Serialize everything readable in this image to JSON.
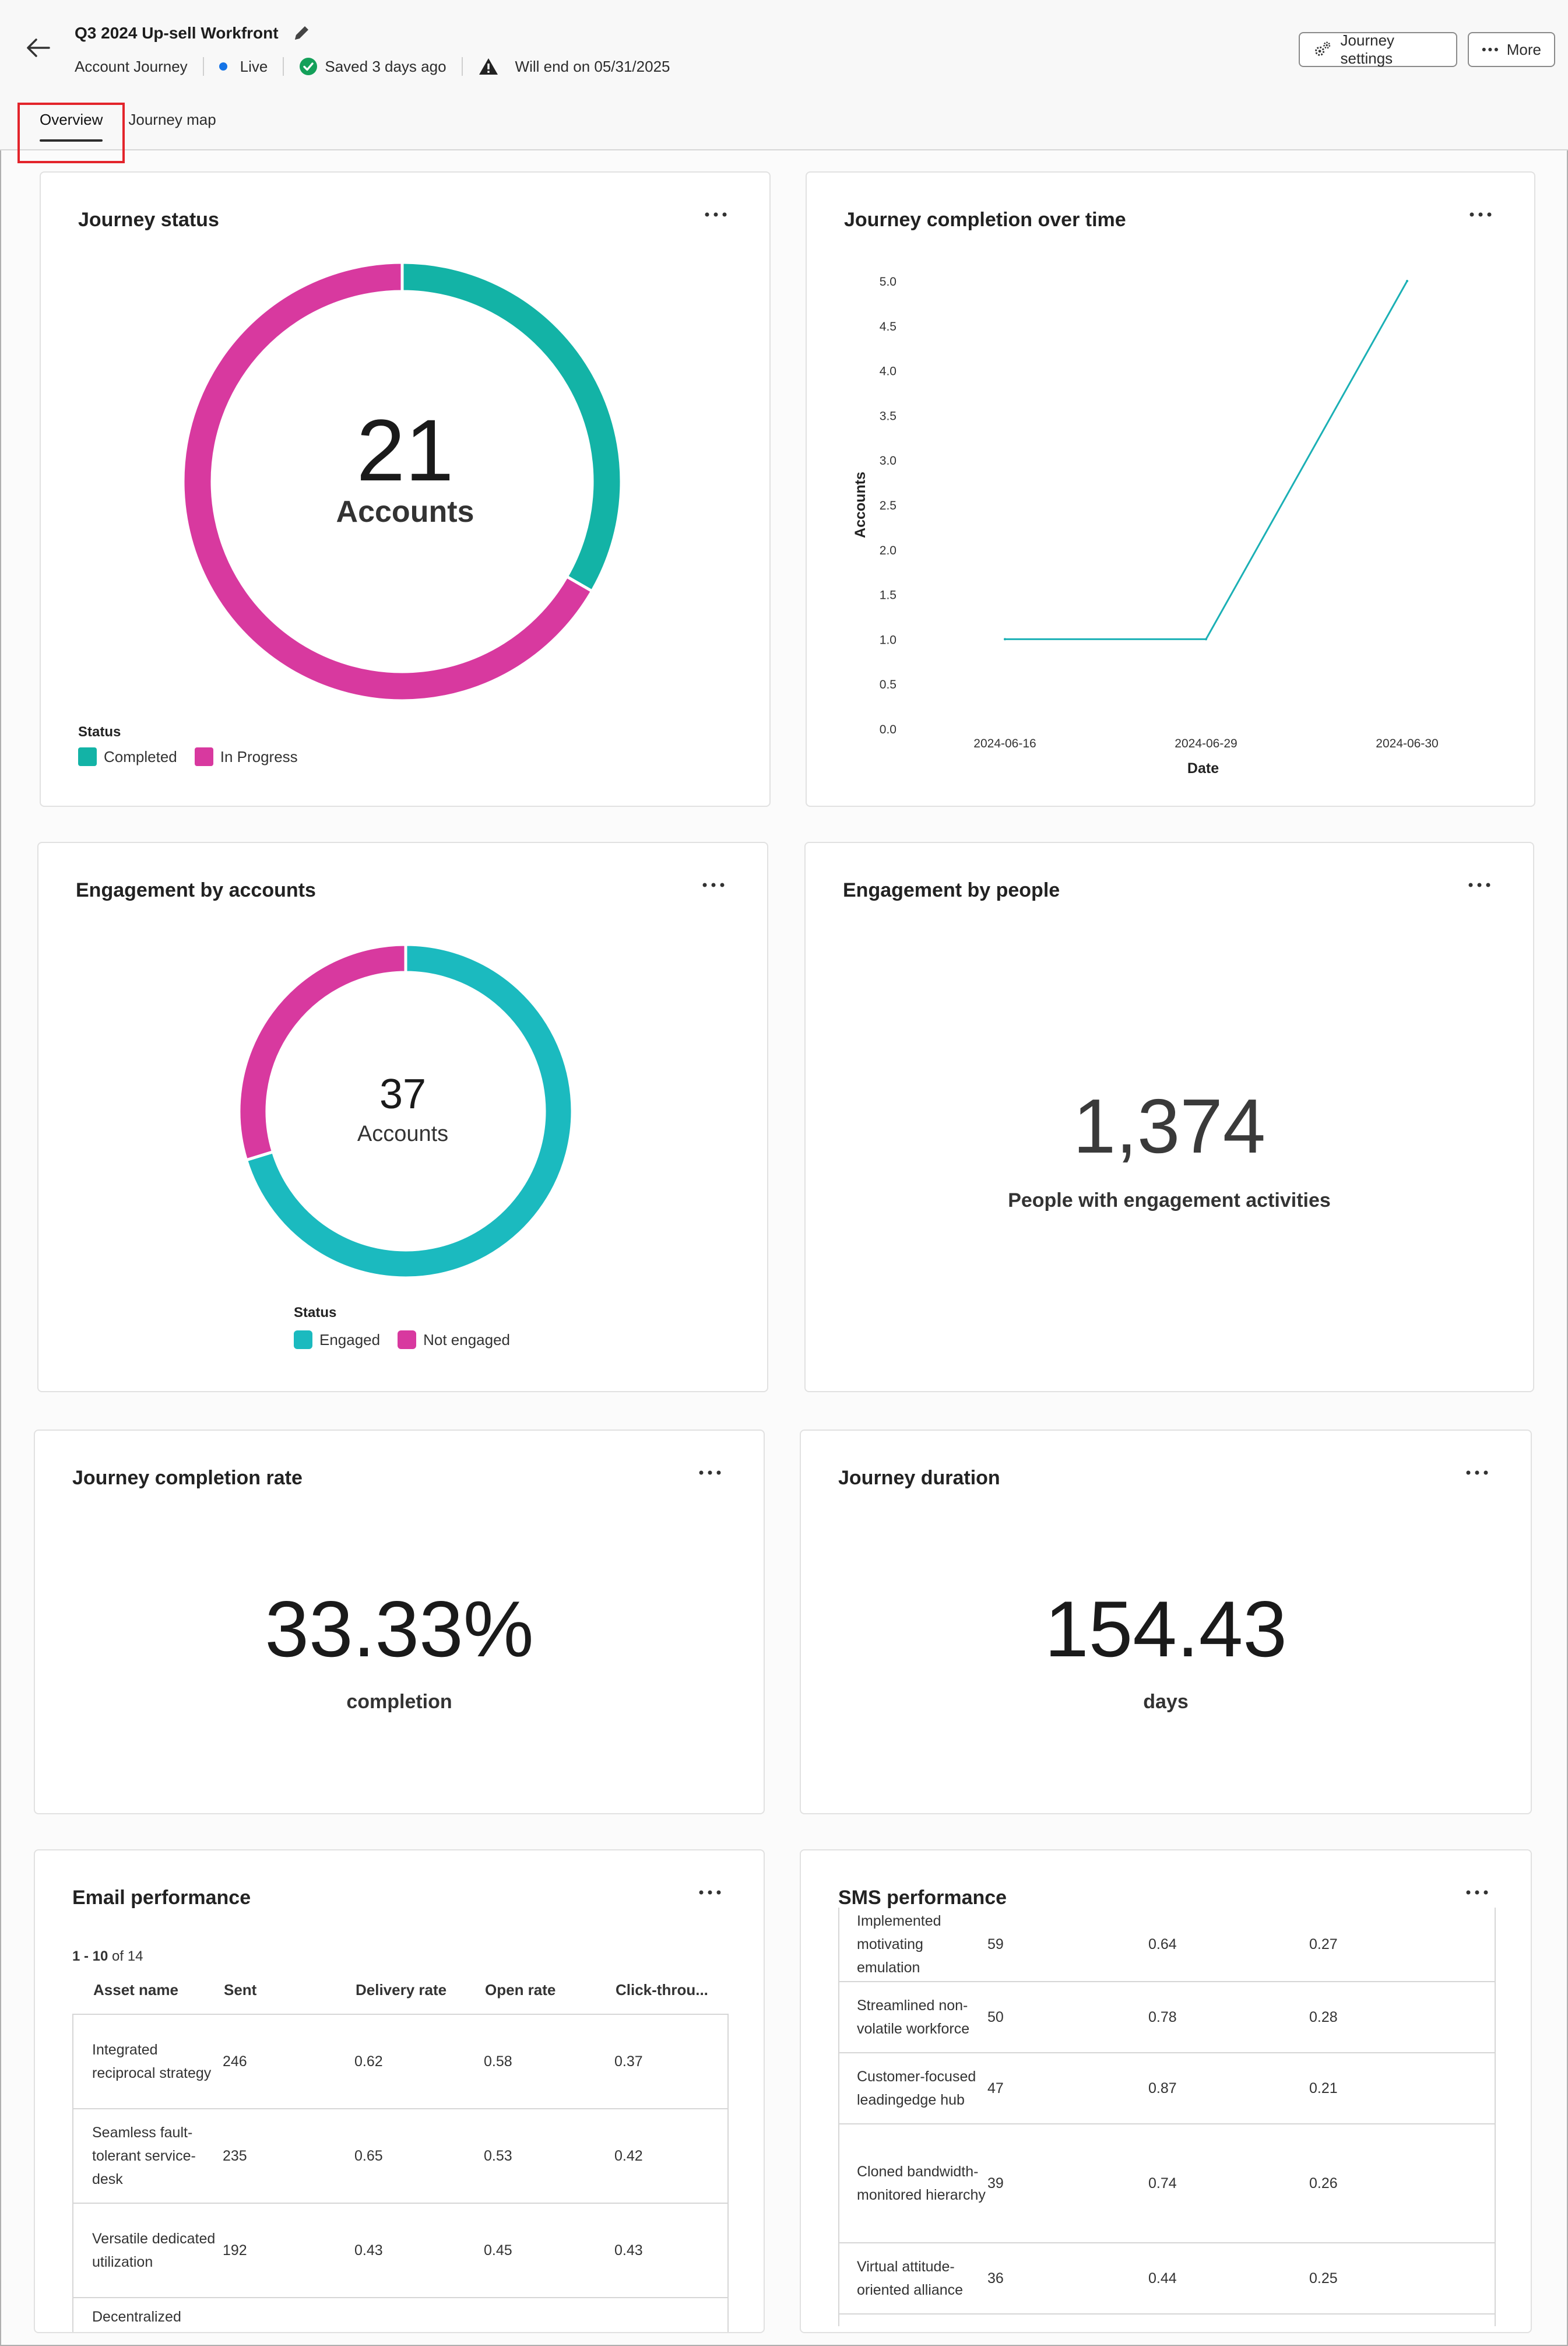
{
  "header": {
    "back_icon": "arrow-left-icon",
    "title": "Q3 2024 Up-sell Workfront",
    "journey_type": "Account Journey",
    "status": "Live",
    "saved": "Saved 3 days ago",
    "end_notice": "Will end on 05/31/2025",
    "settings_label": "Journey settings",
    "more_label": "More"
  },
  "tabs": [
    {
      "label": "Overview",
      "active": true
    },
    {
      "label": "Journey map",
      "active": false
    }
  ],
  "colors": {
    "completed": "#13b3a6",
    "in_progress": "#d8399f",
    "engaged": "#1bbabf",
    "not_engaged": "#d8399f",
    "line": "#1bb0b5",
    "live_dot": "#1473e6",
    "saved_check": "#14a05a",
    "highlight": "#e3242b"
  },
  "journey_status": {
    "title": "Journey status",
    "total": "21",
    "total_label": "Accounts",
    "legend_title": "Status",
    "legend": [
      "Completed",
      "In Progress"
    ]
  },
  "completion_over_time": {
    "title": "Journey completion over time"
  },
  "engagement_accounts": {
    "title": "Engagement by accounts",
    "total": "37",
    "total_label": "Accounts",
    "legend_title": "Status",
    "legend": [
      "Engaged",
      "Not engaged"
    ]
  },
  "engagement_people": {
    "title": "Engagement by people",
    "value": "1,374",
    "label": "People with engagement activities"
  },
  "completion_rate": {
    "title": "Journey completion rate",
    "value": "33.33%",
    "label": "completion"
  },
  "duration": {
    "title": "Journey duration",
    "value": "154.43",
    "label": "days"
  },
  "email_performance": {
    "title": "Email performance",
    "range": "1 - 10",
    "of": "of 14",
    "columns": [
      "Asset name",
      "Sent",
      "Delivery rate",
      "Open rate",
      "Click-throu..."
    ],
    "rows": [
      [
        "Integrated reciprocal strategy",
        "246",
        "0.62",
        "0.58",
        "0.37"
      ],
      [
        "Seamless fault-tolerant service-desk",
        "235",
        "0.65",
        "0.53",
        "0.42"
      ],
      [
        "Versatile dedicated utilization",
        "192",
        "0.43",
        "0.45",
        "0.43"
      ],
      [
        "Decentralized",
        "",
        "",
        "",
        ""
      ]
    ]
  },
  "sms_performance": {
    "title": "SMS performance",
    "rows": [
      [
        "Implemented motivating emulation",
        "59",
        "0.64",
        "0.27"
      ],
      [
        "Streamlined non-volatile workforce",
        "50",
        "0.78",
        "0.28"
      ],
      [
        "Customer-focused leadingedge hub",
        "47",
        "0.87",
        "0.21"
      ],
      [
        "Cloned bandwidth-monitored hierarchy",
        "39",
        "0.74",
        "0.26"
      ],
      [
        "Virtual attitude-oriented alliance",
        "36",
        "0.44",
        "0.25"
      ]
    ]
  },
  "chart_data": [
    {
      "type": "pie",
      "title": "Journey status",
      "categories": [
        "Completed",
        "In Progress"
      ],
      "values": [
        7,
        14
      ]
    },
    {
      "type": "line",
      "title": "Journey completion over time",
      "xlabel": "Date",
      "ylabel": "Accounts",
      "x": [
        "2024-06-16",
        "2024-06-29",
        "2024-06-30"
      ],
      "values": [
        1.0,
        1.0,
        5.0
      ],
      "ylim": [
        0,
        5
      ],
      "yticks": [
        "0.0",
        "0.5",
        "1.0",
        "1.5",
        "2.0",
        "2.5",
        "3.0",
        "3.5",
        "4.0",
        "4.5",
        "5.0"
      ],
      "grid": false
    },
    {
      "type": "pie",
      "title": "Engagement by accounts",
      "categories": [
        "Engaged",
        "Not engaged"
      ],
      "values": [
        26,
        11
      ]
    }
  ]
}
